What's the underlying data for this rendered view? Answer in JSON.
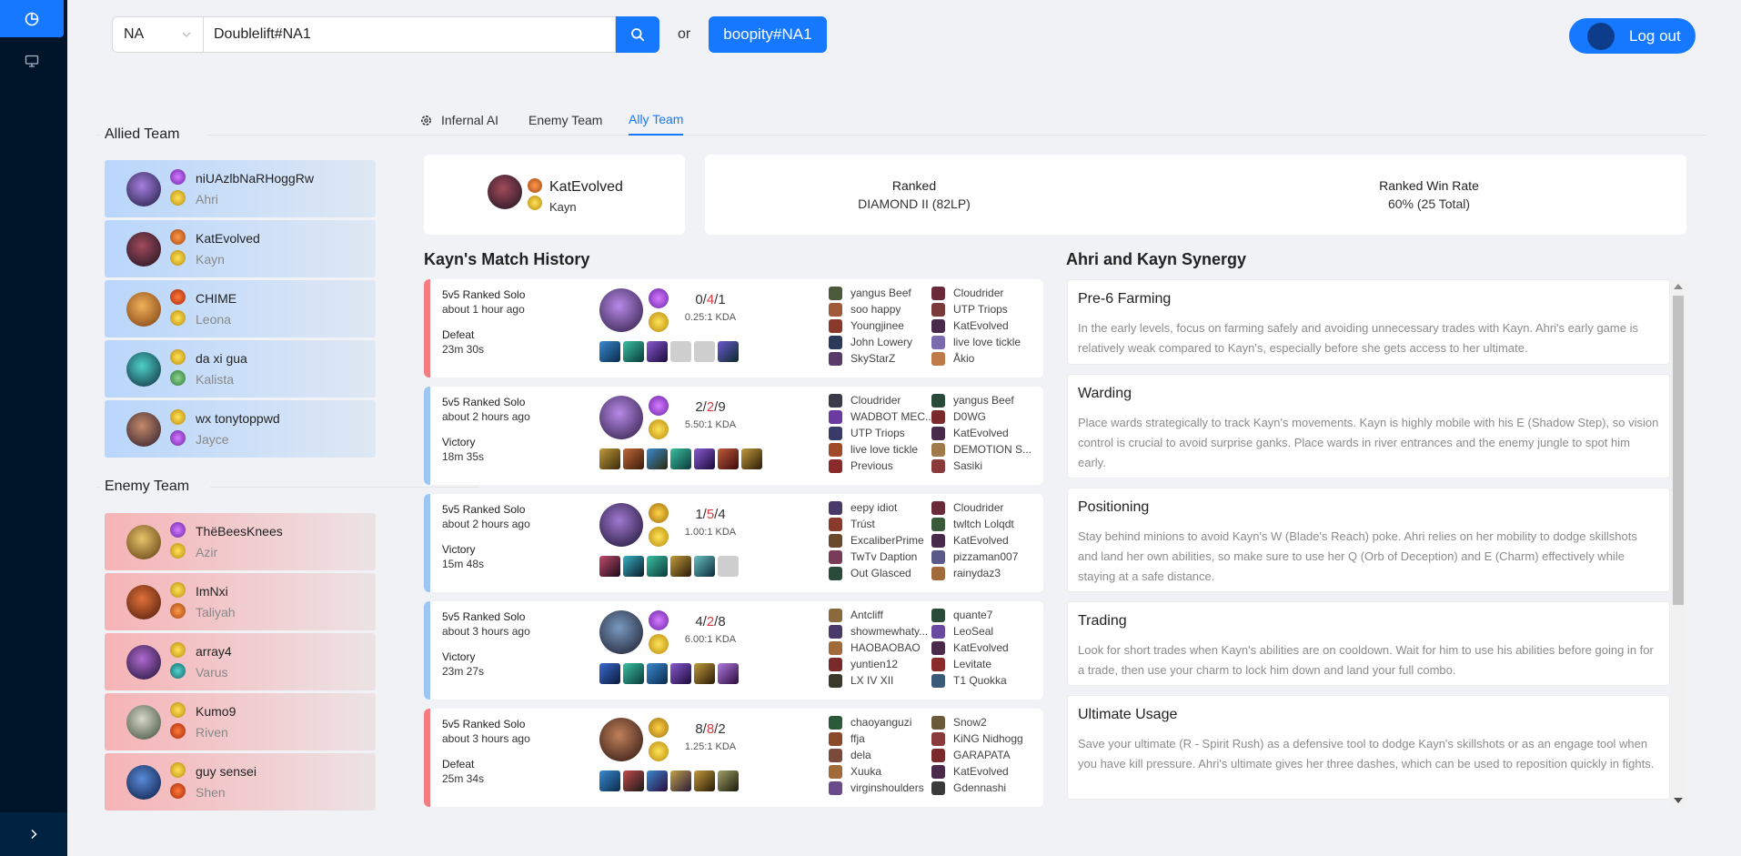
{
  "colors": {
    "accent": "#1677ff",
    "sider": "#001529",
    "loss": "#f47c7f",
    "win": "#9ec6f4"
  },
  "header": {
    "region": "NA",
    "summoner_value": "Doublelift#NA1",
    "or_label": "or",
    "recent_button": "boopity#NA1",
    "logout_label": "Log out"
  },
  "allied": {
    "title": "Allied Team",
    "players": [
      {
        "name": "niUAzlbNaRHoggRw",
        "champion": "Ahri"
      },
      {
        "name": "KatEvolved",
        "champion": "Kayn"
      },
      {
        "name": "CHIME",
        "champion": "Leona"
      },
      {
        "name": "da xi gua",
        "champion": "Kalista"
      },
      {
        "name": "wx tonytoppwd",
        "champion": "Jayce"
      }
    ]
  },
  "enemy": {
    "title": "Enemy Team",
    "players": [
      {
        "name": "ThëBeesKnees",
        "champion": "Azir"
      },
      {
        "name": "ImNxi",
        "champion": "Taliyah"
      },
      {
        "name": "array4",
        "champion": "Varus"
      },
      {
        "name": "Kumo9",
        "champion": "Riven"
      },
      {
        "name": "guy sensei",
        "champion": "Shen"
      }
    ]
  },
  "tabs": [
    "Infernal AI",
    "Enemy Team",
    "Ally Team"
  ],
  "selected": {
    "name": "KatEvolved",
    "champion": "Kayn",
    "ranked_label": "Ranked",
    "ranked_value": "DIAMOND II (82LP)",
    "winrate_label": "Ranked Win Rate",
    "winrate_value": "60% (25 Total)"
  },
  "match_history": {
    "title": "Kayn's Match History",
    "matches": [
      {
        "queue": "5v5 Ranked Solo",
        "ago": "about 1 hour ago",
        "result": "Defeat",
        "duration": "23m 30s",
        "k": "0",
        "d": "4",
        "a": "1",
        "kda": "0.25:1 KDA",
        "team1": [
          "yangus Beef",
          "soo happy",
          "Youngjinee",
          "John Lowery",
          "SkyStarZ"
        ],
        "team2": [
          "Cloudrider",
          "UTP Triops",
          "KatEvolved",
          "live love tickle",
          "Åkio"
        ]
      },
      {
        "queue": "5v5 Ranked Solo",
        "ago": "about 2 hours ago",
        "result": "Victory",
        "duration": "18m 35s",
        "k": "2",
        "d": "2",
        "a": "9",
        "kda": "5.50:1 KDA",
        "team1": [
          "Cloudrider",
          "WADBOT MEC...",
          "UTP Triops",
          "live love tickle",
          "Previous"
        ],
        "team2": [
          "yangus Beef",
          "D0WG",
          "KatEvolved",
          "DEMOTION S...",
          "Sasiki"
        ]
      },
      {
        "queue": "5v5 Ranked Solo",
        "ago": "about 2 hours ago",
        "result": "Victory",
        "duration": "15m 48s",
        "k": "1",
        "d": "5",
        "a": "4",
        "kda": "1.00:1 KDA",
        "team1": [
          "eepy idiot",
          "Trúst",
          "ExcaliberPrime",
          "TwTv Daption",
          "Out Glasced"
        ],
        "team2": [
          "Cloudrider",
          "twltch Lolqdt",
          "KatEvolved",
          "pizzaman007",
          "rainydaz3"
        ]
      },
      {
        "queue": "5v5 Ranked Solo",
        "ago": "about 3 hours ago",
        "result": "Victory",
        "duration": "23m 27s",
        "k": "4",
        "d": "2",
        "a": "8",
        "kda": "6.00:1 KDA",
        "team1": [
          "Antcliff",
          "showmewhaty...",
          "HAOBAOBAO",
          "yuntien12",
          "LX IV XII"
        ],
        "team2": [
          "quante7",
          "LeoSeal",
          "KatEvolved",
          "Levitate",
          "T1 Quokka"
        ]
      },
      {
        "queue": "5v5 Ranked Solo",
        "ago": "about 3 hours ago",
        "result": "Defeat",
        "duration": "25m 34s",
        "k": "8",
        "d": "8",
        "a": "2",
        "kda": "1.25:1 KDA",
        "team1": [
          "chaoyanguzi",
          "ffja",
          "dela",
          "Xuuka",
          "virginshoulders"
        ],
        "team2": [
          "Snow2",
          "KiNG Nidhogg",
          "GARAPATA",
          "KatEvolved",
          "Gdennashi"
        ]
      }
    ]
  },
  "synergy": {
    "title": "Ahri and Kayn Synergy",
    "tips": [
      {
        "title": "Pre-6 Farming",
        "text": "In the early levels, focus on farming safely and avoiding unnecessary trades with Kayn. Ahri's early game is relatively weak compared to Kayn's, especially before she gets access to her ultimate."
      },
      {
        "title": "Warding",
        "text": "Place wards strategically to track Kayn's movements. Kayn is highly mobile with his E (Shadow Step), so vision control is crucial to avoid surprise ganks. Place wards in river entrances and the enemy jungle to spot him early."
      },
      {
        "title": "Positioning",
        "text": "Stay behind minions to avoid Kayn's W (Blade's Reach) poke. Ahri relies on her mobility to dodge skillshots and land her own abilities, so make sure to use her Q (Orb of Deception) and E (Charm) effectively while staying at a safe distance."
      },
      {
        "title": "Trading",
        "text": "Look for short trades when Kayn's abilities are on cooldown. Wait for him to use his abilities before going in for a trade, then use your charm to lock him down and land your full combo."
      },
      {
        "title": "Ultimate Usage",
        "text": "Save your ultimate (R - Spirit Rush) as a defensive tool to dodge Kayn's skillshots or as an engage tool when you have kill pressure. Ahri's ultimate gives her three dashes, which can be used to reposition quickly in fights."
      }
    ]
  }
}
